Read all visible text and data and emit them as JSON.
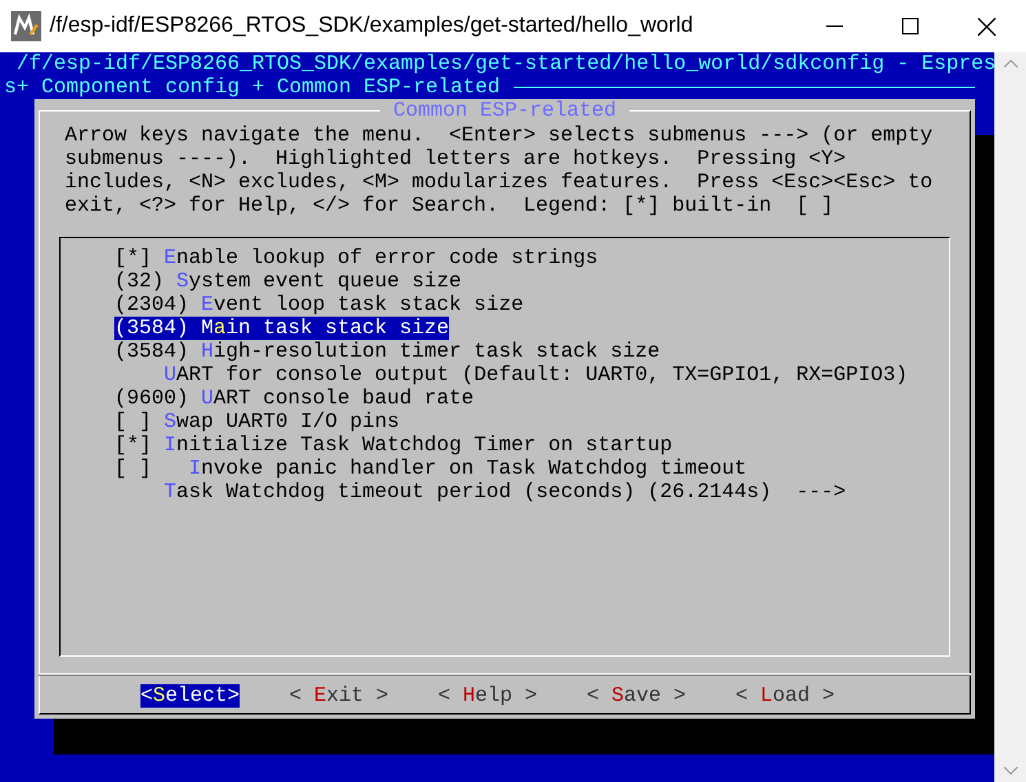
{
  "window": {
    "title": "/f/esp-idf/ESP8266_RTOS_SDK/examples/get-started/hello_world"
  },
  "terminal": {
    "path_line": "/f/esp-idf/ESP8266_RTOS_SDK/examples/get-started/hello_world/sdkconfig - Espres",
    "breadcrumb": "s+ Component config + Common ESP-related"
  },
  "dialog": {
    "title": "Common ESP-related",
    "help_lines": [
      "Arrow keys navigate the menu.  <Enter> selects submenus ---> (or empty",
      "submenus ----).  Highlighted letters are hotkeys.  Pressing <Y>",
      "includes, <N> excludes, <M> modularizes features.  Press <Esc><Esc> to",
      "exit, <?> for Help, </> for Search.  Legend: [*] built-in  [ ]"
    ],
    "items": [
      {
        "prefix": "[*] ",
        "hotkey": "E",
        "rest": "nable lookup of error code strings",
        "selected": false
      },
      {
        "prefix": "(32) ",
        "hotkey": "S",
        "rest": "ystem event queue size",
        "selected": false
      },
      {
        "prefix": "(2304) ",
        "hotkey": "E",
        "rest": "vent loop task stack size",
        "selected": false
      },
      {
        "prefix": "(3584) M",
        "hotkey": "a",
        "rest": "in task stack size",
        "selected": true
      },
      {
        "prefix": "(3584) ",
        "hotkey": "H",
        "rest": "igh-resolution timer task stack size",
        "selected": false
      },
      {
        "hotkey": "U",
        "rest": "ART for console output (Default: UART0, TX=GPIO1, RX=GPIO3)",
        "selected": false
      },
      {
        "prefix": "(9600) ",
        "hotkey": "U",
        "rest": "ART console baud rate",
        "selected": false
      },
      {
        "prefix": "[ ] ",
        "hotkey": "S",
        "rest": "wap UART0 I/O pins",
        "selected": false
      },
      {
        "prefix": "[*] ",
        "hotkey": "I",
        "rest": "nitialize Task Watchdog Timer on startup",
        "selected": false
      },
      {
        "prefix": "[ ]   ",
        "hotkey": "I",
        "rest": "nvoke panic handler on Task Watchdog timeout",
        "selected": false
      },
      {
        "hotkey": "T",
        "rest": "ask Watchdog timeout period (seconds) (26.2144s)  --->",
        "selected": false
      }
    ],
    "buttons": [
      {
        "open": "<",
        "hotkey": "S",
        "rest": "elect",
        "close": ">",
        "selected": true
      },
      {
        "open": "< ",
        "hotkey": "E",
        "rest": "xit",
        "close": " >",
        "selected": false
      },
      {
        "open": "< ",
        "hotkey": "H",
        "rest": "elp",
        "close": " >",
        "selected": false
      },
      {
        "open": "< ",
        "hotkey": "S",
        "rest": "ave",
        "close": " >",
        "selected": false
      },
      {
        "open": "< ",
        "hotkey": "L",
        "rest": "oad",
        "close": " >",
        "selected": false
      }
    ]
  }
}
